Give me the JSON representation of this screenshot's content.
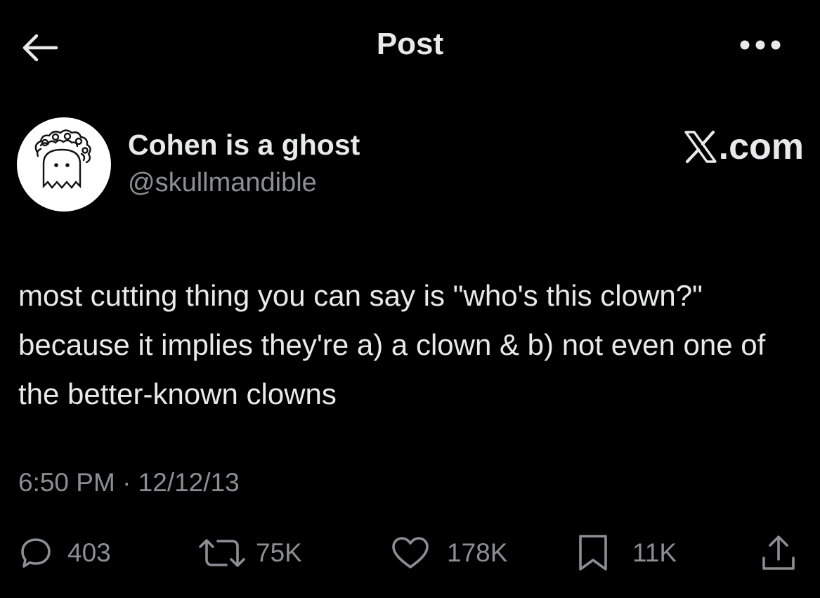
{
  "header": {
    "title": "Post",
    "back_icon": "arrow-left-icon",
    "more_icon": "more-horizontal-icon"
  },
  "author": {
    "name": "Cohen is a ghost",
    "handle": "@skullmandible",
    "avatar_icon": "ghost-avatar"
  },
  "brand": {
    "text": ".com",
    "icon": "x-logo-icon"
  },
  "post": {
    "text": "most cutting thing you can say is \"who's this clown?\" because it implies they're a) a clown & b) not even one of the better-known clowns",
    "timestamp": "6:50 PM · 12/12/13"
  },
  "actions": {
    "replies": "403",
    "reposts": "75K",
    "likes": "178K",
    "bookmarks": "11K",
    "share_icon": "share-icon"
  },
  "colors": {
    "background": "#000000",
    "primary_text": "#e7e9ea",
    "secondary_text": "#8b8f94"
  }
}
